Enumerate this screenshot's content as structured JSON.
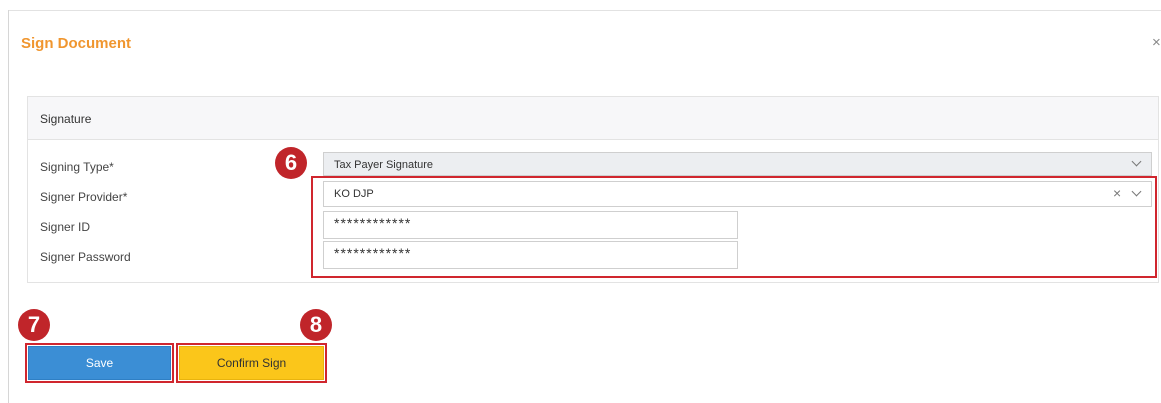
{
  "dialog": {
    "title": "Sign Document",
    "close_glyph": "×"
  },
  "panel": {
    "title": "Signature"
  },
  "form": {
    "signing_type": {
      "label": "Signing Type*",
      "value": "Tax Payer Signature"
    },
    "signer_provider": {
      "label": "Signer Provider*",
      "value": "KO DJP",
      "clear_glyph": "×"
    },
    "signer_id": {
      "label": "Signer ID",
      "value": "************"
    },
    "signer_password": {
      "label": "Signer Password",
      "value": "************"
    }
  },
  "buttons": {
    "save": "Save",
    "confirm_sign": "Confirm Sign"
  },
  "annotations": {
    "badge_6": "6",
    "badge_7": "7",
    "badge_8": "8"
  },
  "colors": {
    "title": "#f0962f",
    "highlight": "#d0262e",
    "badge": "#c0252a",
    "save_button": "#3b8ed5",
    "confirm_button": "#fbc61a"
  }
}
